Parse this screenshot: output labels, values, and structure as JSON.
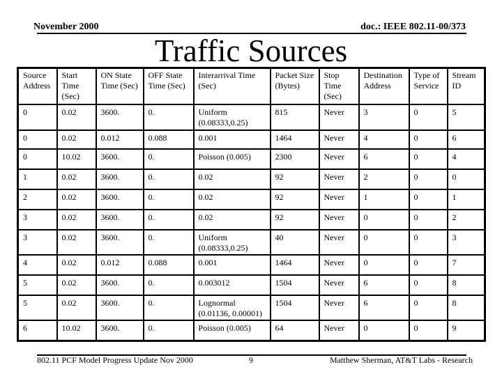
{
  "header": {
    "date": "November 2000",
    "doc_id": "doc.: IEEE 802.11-00/373"
  },
  "title": "Traffic Sources",
  "table": {
    "columns": [
      "Source Address",
      "Start Time (Sec)",
      "ON State Time (Sec)",
      "OFF State Time (Sec)",
      "Interarrival Time (Sec)",
      "Packet Size (Bytes)",
      "Stop Time (Sec)",
      "Destination Address",
      "Type of Service",
      "Stream ID"
    ],
    "rows": [
      [
        "0",
        "0.02",
        "3600.",
        "0.",
        "Uniform (0.08333,0.25)",
        "815",
        "Never",
        "3",
        "0",
        "5"
      ],
      [
        "0",
        "0.02",
        "0.012",
        "0.088",
        "0.001",
        "1464",
        "Never",
        "4",
        "0",
        "6"
      ],
      [
        "0",
        "10.02",
        "3600.",
        "0.",
        "Poisson (0.005)",
        "2300",
        "Never",
        "6",
        "0",
        "4"
      ],
      [
        "1",
        "0.02",
        "3600.",
        "0.",
        "0.02",
        "92",
        "Never",
        "2",
        "0",
        "0"
      ],
      [
        "2",
        "0.02",
        "3600.",
        "0.",
        "0.02",
        "92",
        "Never",
        "1",
        "0",
        "1"
      ],
      [
        "3",
        "0.02",
        "3600.",
        "0.",
        "0.02",
        "92",
        "Never",
        "0",
        "0",
        "2"
      ],
      [
        "3",
        "0.02",
        "3600.",
        "0.",
        "Uniform (0.08333,0.25)",
        "40",
        "Never",
        "0",
        "0",
        "3"
      ],
      [
        "4",
        "0.02",
        "0.012",
        "0.088",
        "0.001",
        "1464",
        "Never",
        "0",
        "0",
        "7"
      ],
      [
        "5",
        "0.02",
        "3600.",
        "0.",
        "0.003012",
        "1504",
        "Never",
        "6",
        "0",
        "8"
      ],
      [
        "5",
        "0.02",
        "3600.",
        "0.",
        "Lognormal (0.01136, 0.00001)",
        "1504",
        "Never",
        "6",
        "0",
        "8"
      ],
      [
        "6",
        "10.02",
        "3600.",
        "0.",
        "Poisson (0.005)",
        "64",
        "Never",
        "0",
        "0",
        "9"
      ]
    ]
  },
  "footer": {
    "left": "802.11 PCF Model Progress Update Nov 2000",
    "page": "9",
    "right": "Matthew Sherman, AT&T Labs - Research"
  }
}
